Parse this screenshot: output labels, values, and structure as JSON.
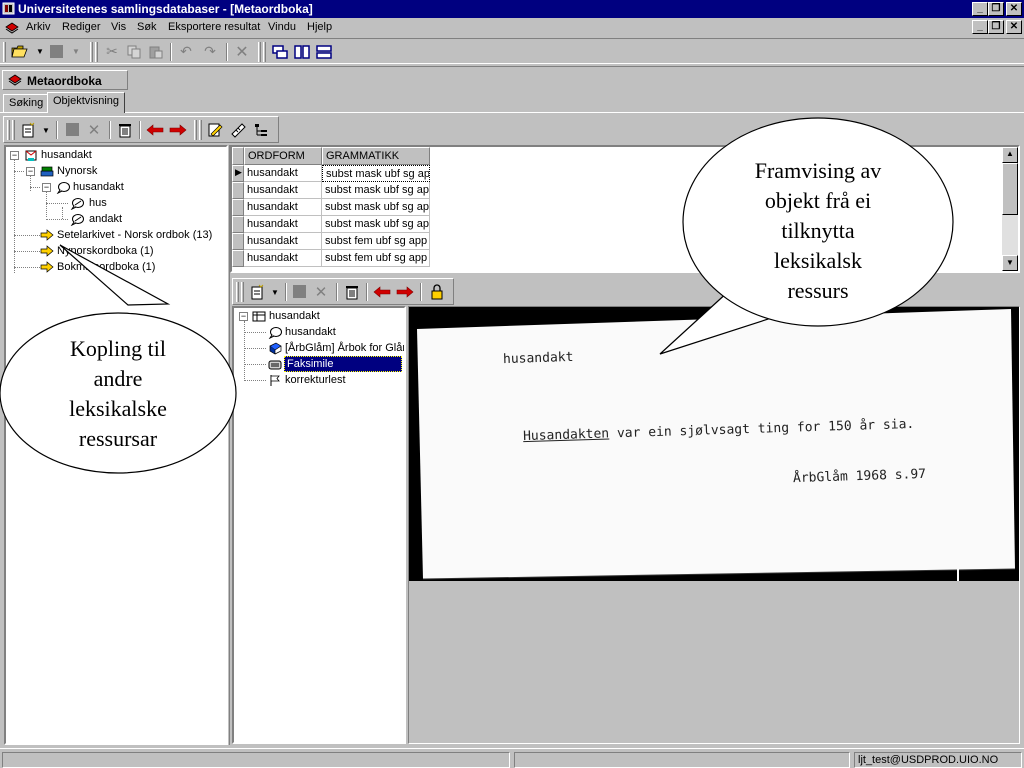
{
  "window": {
    "title": "Universitetenes samlingsdatabaser - [Metaordboka]"
  },
  "menu": {
    "items": [
      "Arkiv",
      "Rediger",
      "Vis",
      "Søk",
      "Eksportere resultat",
      "Vindu",
      "Hjelp"
    ]
  },
  "child_window": {
    "title": "Metaordboka"
  },
  "tabs": [
    "Søking",
    "Objektvisning"
  ],
  "active_tab": "Objektvisning",
  "left_tree": {
    "root": "husandakt",
    "items": [
      {
        "label": "Nynorsk"
      },
      {
        "label": "husandakt"
      },
      {
        "label": "hus"
      },
      {
        "label": "andakt"
      },
      {
        "label": "Setelarkivet - Norsk ordbok (13)"
      },
      {
        "label": "Nynorskordboka (1)"
      },
      {
        "label": "Bokmålsordboka (1)"
      }
    ]
  },
  "grid": {
    "columns": [
      "ORDFORM",
      "GRAMMATIKK"
    ],
    "rows": [
      [
        "husandakt",
        "subst mask ubf sg ap"
      ],
      [
        "husandakt",
        "subst mask ubf sg ap"
      ],
      [
        "husandakt",
        "subst mask ubf sg ap"
      ],
      [
        "husandakt",
        "subst mask ubf sg ap"
      ],
      [
        "husandakt",
        "subst fem ubf sg app"
      ],
      [
        "husandakt",
        "subst fem ubf sg app"
      ]
    ]
  },
  "object_tree": {
    "root": "husandakt",
    "items": [
      {
        "label": "husandakt"
      },
      {
        "label": "[ÅrbGlåm] Årbok for Glåm"
      },
      {
        "label": "Faksimile"
      },
      {
        "label": "korrekturlest"
      }
    ],
    "selected": "Faksimile"
  },
  "facsimile": {
    "headword": "husandakt",
    "quote_underlined": "Husandakten",
    "quote_rest": " var ein sjølvsagt ting for 150 år sia.",
    "source": "ÅrbGlåm 1968  s.97"
  },
  "callouts": {
    "left": [
      "Kopling til",
      "andre",
      "leksikalske",
      "ressursar"
    ],
    "right": [
      "Framvising av",
      "objekt frå ei",
      "tilknytta",
      "leksikalsk",
      "ressurs"
    ]
  },
  "status": {
    "user": "ljt_test@USDPROD.UIO.NO"
  },
  "colors": {
    "titlebar": "#000080",
    "face": "#c0c0c0",
    "selection": "#000080",
    "arrow_red": "#d00000"
  }
}
